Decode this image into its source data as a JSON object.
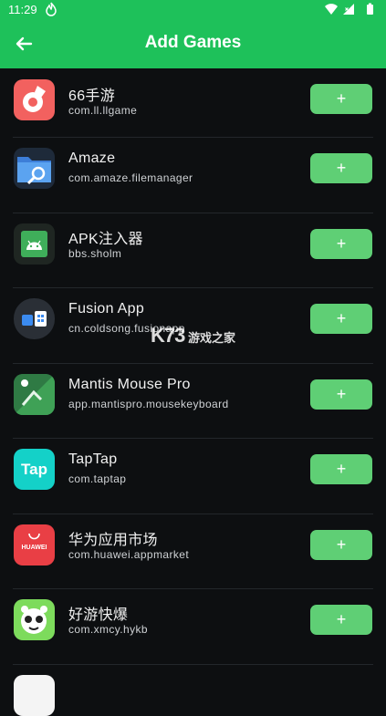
{
  "status_bar": {
    "time": "11:29",
    "notification_icon": "flame-icon",
    "icons": [
      "wifi-icon",
      "signal-icon",
      "battery-icon"
    ]
  },
  "header": {
    "title": "Add Games",
    "back_icon": "arrow-left-icon"
  },
  "add_button_label": "+",
  "apps": [
    {
      "name": "66手游",
      "package": "com.ll.llgame",
      "icon": "66-game-icon"
    },
    {
      "name": "Amaze",
      "package": "com.amaze.filemanager",
      "icon": "amaze-icon"
    },
    {
      "name": "APK注入器",
      "package": "bbs.sholm",
      "icon": "android-icon"
    },
    {
      "name": "Fusion App",
      "package": "cn.coldsong.fusionapp",
      "icon": "fusion-app-icon"
    },
    {
      "name": "Mantis Mouse Pro",
      "package": "app.mantispro.mousekeyboard",
      "icon": "mantis-icon"
    },
    {
      "name": "TapTap",
      "package": "com.taptap",
      "icon": "taptap-icon",
      "icon_text": "Tap"
    },
    {
      "name": "华为应用市场",
      "package": "com.huawei.appmarket",
      "icon": "huawei-appgallery-icon",
      "icon_text": "HUAWEI"
    },
    {
      "name": "好游快爆",
      "package": "com.xmcy.hykb",
      "icon": "hykb-icon"
    }
  ],
  "watermark": "游戏之家",
  "colors": {
    "accent": "#1ec15a",
    "button": "#5fcf75",
    "background": "#0d0f11"
  }
}
